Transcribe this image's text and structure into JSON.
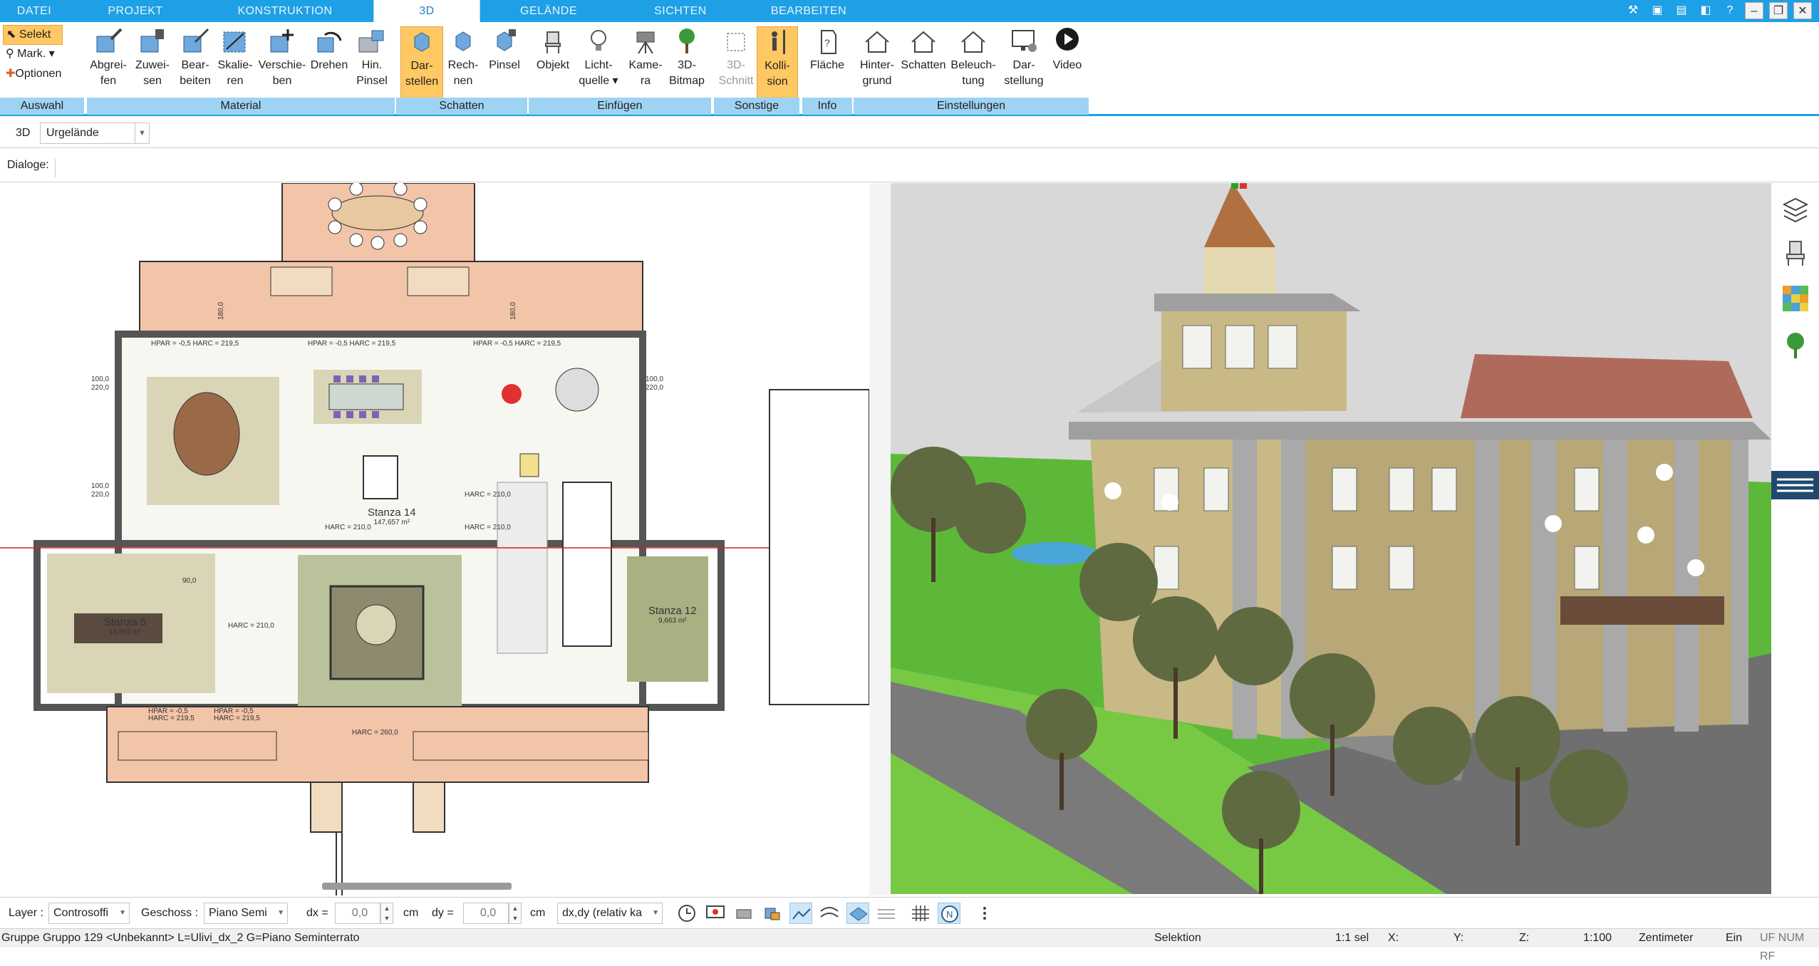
{
  "tabs": [
    {
      "label": "DATEI",
      "active": false
    },
    {
      "label": "PROJEKT",
      "active": false
    },
    {
      "label": "KONSTRUKTION",
      "active": false
    },
    {
      "label": "3D",
      "active": true
    },
    {
      "label": "GELÄNDE",
      "active": false
    },
    {
      "label": "SICHTEN",
      "active": false
    },
    {
      "label": "BEARBEITEN",
      "active": false
    }
  ],
  "ribbon": {
    "auswahl": {
      "selekt": "Selekt",
      "mark": "Mark.",
      "optionen": "Optionen",
      "group": "Auswahl"
    },
    "material": {
      "group": "Material",
      "buttons": [
        {
          "l1": "Abgrei-",
          "l2": "fen"
        },
        {
          "l1": "Zuwei-",
          "l2": "sen"
        },
        {
          "l1": "Bear-",
          "l2": "beiten"
        },
        {
          "l1": "Skalie-",
          "l2": "ren"
        },
        {
          "l1": "Verschie-",
          "l2": "ben"
        },
        {
          "l1": "Drehen",
          "l2": ""
        },
        {
          "l1": "Hin.",
          "l2": "Pinsel"
        }
      ]
    },
    "schatten": {
      "group": "Schatten",
      "buttons": [
        {
          "l1": "Dar-",
          "l2": "stellen",
          "active": true
        },
        {
          "l1": "Rech-",
          "l2": "nen"
        },
        {
          "l1": "Pinsel",
          "l2": ""
        }
      ]
    },
    "einfuegen": {
      "group": "Einfügen",
      "buttons": [
        {
          "l1": "Objekt",
          "l2": ""
        },
        {
          "l1": "Licht-",
          "l2": "quelle"
        },
        {
          "l1": "Kame-",
          "l2": "ra"
        },
        {
          "l1": "3D-",
          "l2": "Bitmap"
        }
      ]
    },
    "sonstige": {
      "group": "Sonstige",
      "buttons": [
        {
          "l1": "3D-",
          "l2": "Schnitt",
          "dim": true
        },
        {
          "l1": "Kolli-",
          "l2": "sion",
          "active": true
        }
      ]
    },
    "info": {
      "group": "Info",
      "buttons": [
        {
          "l1": "Fläche",
          "l2": ""
        }
      ]
    },
    "einstellungen": {
      "group": "Einstellungen",
      "buttons": [
        {
          "l1": "Hinter-",
          "l2": "grund"
        },
        {
          "l1": "Schatten",
          "l2": ""
        },
        {
          "l1": "Beleuch-",
          "l2": "tung"
        },
        {
          "l1": "Dar-",
          "l2": "stellung"
        },
        {
          "l1": "Video",
          "l2": ""
        }
      ]
    }
  },
  "subbar": {
    "mode": "3D",
    "terrain": "Urgelände"
  },
  "dialoge": "Dialoge:",
  "plan": {
    "rooms": [
      {
        "name": "Stanza 14",
        "area": "147,657 m²"
      },
      {
        "name": "Stanza 5",
        "area": "19,503 m²"
      },
      {
        "name": "Stanza 12",
        "area": "9,663 m²"
      }
    ],
    "dims": {
      "d90": "90,0",
      "d220": "220,0",
      "d180": "180,0",
      "d100": "100,0",
      "harc210": "HARC = 210,0",
      "harc2195": "HARC = 219,5",
      "harc260": "HARC = 260,0",
      "hpar05": "HPAR = -0,5",
      "hpar2195": "HPAR = -0,5 HARC = 219,5"
    }
  },
  "layerbar": {
    "layer_label": "Layer :",
    "layer_value": "Controsoffi",
    "geschoss_label": "Geschoss :",
    "geschoss_value": "Piano Semi",
    "dx_label": "dx =",
    "dx_value": "0,0",
    "dx_unit": "cm",
    "dy_label": "dy =",
    "dy_value": "0,0",
    "dy_unit": "cm",
    "mode_value": "dx,dy (relativ ka"
  },
  "statusbar": {
    "left": "Gruppe Gruppo 129 <Unbekannt> L=Ulivi_dx_2 G=Piano Seminterrato",
    "mode": "Selektion",
    "sel": "1:1 sel",
    "x": "X:",
    "y": "Y:",
    "z": "Z:",
    "scale": "1:100",
    "unit": "Zentimeter",
    "ein": "Ein",
    "flags": "UF NUM RF"
  },
  "colors": {
    "accent": "#1ea0e6",
    "ribbon_group": "#9ed3f3",
    "active_btn": "#ffc862"
  }
}
